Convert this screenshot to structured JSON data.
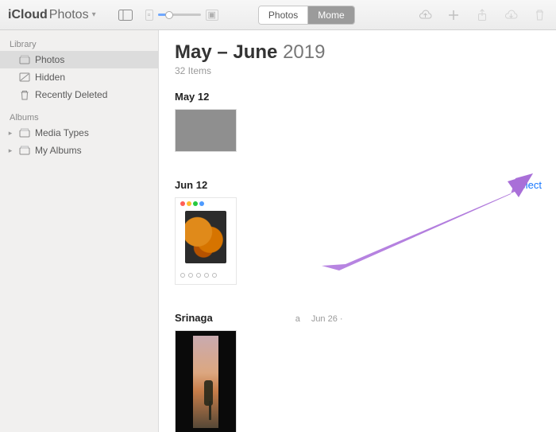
{
  "app": {
    "name_bold": "iCloud",
    "name_rest": "Photos"
  },
  "toolbar": {
    "view_photos": "Photos",
    "view_moments": "Mome"
  },
  "sidebar": {
    "section_library": "Library",
    "section_albums": "Albums",
    "library": [
      {
        "label": "Photos"
      },
      {
        "label": "Hidden"
      },
      {
        "label": "Recently Deleted"
      }
    ],
    "albums": [
      {
        "label": "Media Types"
      },
      {
        "label": "My Albums"
      }
    ]
  },
  "content": {
    "range_bold": "May – June",
    "range_year": "2019",
    "item_count": "32 Items",
    "select_label": "Select",
    "moments": [
      {
        "title": "May 12",
        "sub1": "",
        "sub2": ""
      },
      {
        "title": "Jun 12",
        "sub1": "",
        "sub2": ""
      },
      {
        "title": "Srinaga",
        "sub1": "a",
        "sub2": "Jun 26  ·"
      }
    ]
  },
  "annotation": {
    "arrow_color": "#b47fe0"
  }
}
